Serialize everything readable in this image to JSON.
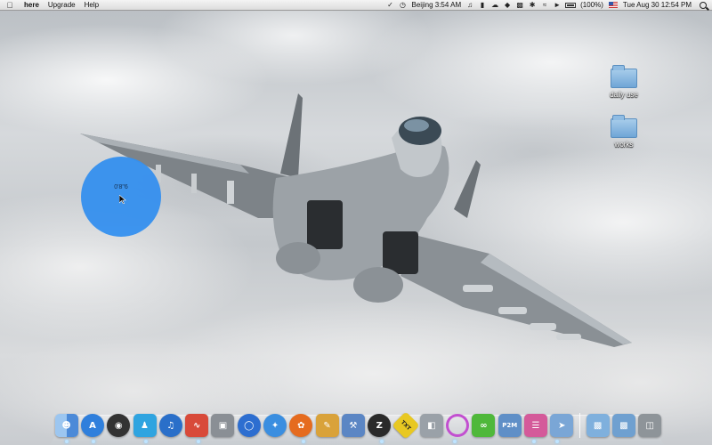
{
  "menubar": {
    "app_name": "here",
    "menus": [
      "Upgrade",
      "Help"
    ],
    "clock_city": "Beijing 3:54 AM",
    "battery": "(100%)",
    "datetime": "Tue Aug 30   12:54 PM"
  },
  "desktop": {
    "folders": [
      {
        "label": "daily use"
      },
      {
        "label": "works"
      }
    ],
    "widget": {
      "text": "0'8\"6",
      "color": "#3590ef"
    }
  },
  "dock": {
    "apps": [
      {
        "icon": "finder-icon",
        "bg": "#4c8ad8"
      },
      {
        "icon": "app-store-icon",
        "bg": "#2f7fdc"
      },
      {
        "icon": "dashboard-icon",
        "bg": "#333333"
      },
      {
        "icon": "messenger-icon",
        "bg": "#2fa4e0"
      },
      {
        "icon": "itunes-icon",
        "bg": "#2a6fc9"
      },
      {
        "icon": "activity-monitor-icon",
        "bg": "#d84a3a"
      },
      {
        "icon": "screenshot-icon",
        "bg": "#8a8f95"
      },
      {
        "icon": "globe-icon",
        "bg": "#2d6ed0"
      },
      {
        "icon": "safari-icon",
        "bg": "#3a8ee0"
      },
      {
        "icon": "firefox-icon",
        "bg": "#e56b1f"
      },
      {
        "icon": "paint-icon",
        "bg": "#d9a23a"
      },
      {
        "icon": "xcode-icon",
        "bg": "#5b86c4"
      },
      {
        "icon": "zip-icon",
        "bg": "#2a2a2a"
      },
      {
        "icon": "txt-icon",
        "bg": "#e8c822"
      },
      {
        "icon": "preview-icon",
        "bg": "#9aa1a8"
      },
      {
        "icon": "ring-icon",
        "bg": "#c24fd0"
      },
      {
        "icon": "chain-icon",
        "bg": "#4fb83a"
      },
      {
        "icon": "p2m-icon",
        "bg": "#5f8fc7"
      },
      {
        "icon": "books-icon",
        "bg": "#d45a9a"
      },
      {
        "icon": "here-icon",
        "bg": "#7aa6d6"
      }
    ],
    "stacks": [
      {
        "icon": "applications-folder-icon",
        "bg": "#7fb0dd"
      },
      {
        "icon": "documents-folder-icon",
        "bg": "#6fa0d0"
      },
      {
        "icon": "trash-icon",
        "bg": "#8e9499"
      }
    ],
    "labels": {
      "zip": "Z",
      "txt": "TXT",
      "p2m": "P2M"
    }
  },
  "colors": {
    "dock_indicator": "#bfe4ff",
    "folder_blue": "#6fa5d6"
  }
}
